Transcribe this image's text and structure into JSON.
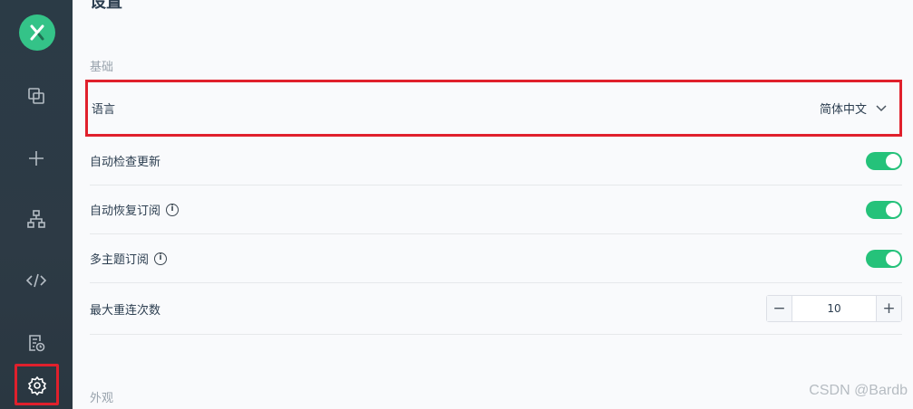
{
  "page_title": "设置",
  "sections": {
    "basic": "基础",
    "appearance": "外观"
  },
  "sidebar": {
    "logo_icon": "mqttx-logo-icon",
    "items": [
      {
        "icon": "connections-icon"
      },
      {
        "icon": "plus-icon"
      },
      {
        "icon": "topology-icon"
      },
      {
        "icon": "code-script-icon"
      },
      {
        "icon": "log-icon"
      },
      {
        "icon": "settings-gear-icon"
      }
    ]
  },
  "settings": {
    "language": {
      "label": "语言",
      "value": "简体中文"
    },
    "auto_check_update": {
      "label": "自动检查更新",
      "enabled": true
    },
    "auto_resub": {
      "label": "自动恢复订阅",
      "enabled": true
    },
    "multi_topic": {
      "label": "多主题订阅",
      "enabled": true
    },
    "max_reconnect": {
      "label": "最大重连次数",
      "value": "10",
      "minus": "−",
      "plus": "+"
    }
  },
  "info_glyph": "i",
  "colors": {
    "accent_green": "#25c27a",
    "highlight_red": "#e0202c",
    "sidebar_bg": "#2b3b46"
  },
  "watermark": "CSDN @Bardb"
}
